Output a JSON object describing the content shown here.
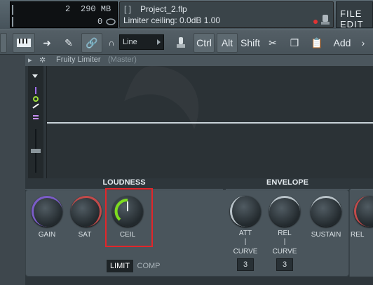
{
  "topbar": {
    "cpu_value": "2",
    "memory": "290 MB",
    "polyphony": "0",
    "project_bracket": "[ ]",
    "project_name": "Project_2.flp",
    "hint_text": "Limiter ceiling: 0.0dB  1.00",
    "menu_label": "FILE EDIT"
  },
  "toolbar": {
    "snap_value": "Line",
    "ctrl_label": "Ctrl",
    "alt_label": "Alt",
    "shift_label": "Shift",
    "add_label": "Add"
  },
  "plugin": {
    "title": "Fruity Limiter",
    "channel": "(Master)",
    "sections": {
      "loudness": "LOUDNESS",
      "envelope": "ENVELOPE"
    },
    "knobs": {
      "gain": "GAIN",
      "sat": "SAT",
      "ceil": "CEIL",
      "att": "ATT",
      "rel": "REL",
      "sustain": "SUSTAIN",
      "rel2": "REL"
    },
    "curve_label": "CURVE",
    "att_curve": "3",
    "rel_curve": "3",
    "tabs": {
      "limit": "LIMIT",
      "comp": "COMP"
    }
  },
  "colors": {
    "highlight": "#e2262a",
    "ceil_arc": "#7ddc1f",
    "gain_arc": "#7b5cc8",
    "sat_arc": "#c24a4a"
  }
}
